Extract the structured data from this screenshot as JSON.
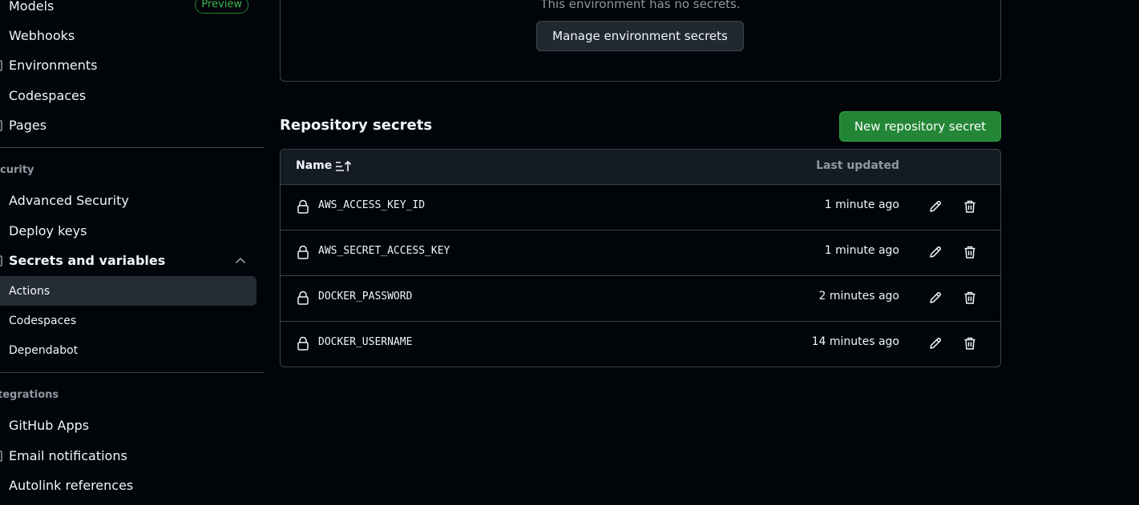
{
  "sidebar": {
    "items": [
      {
        "label": "Models",
        "badge": "Preview"
      },
      {
        "label": "Webhooks"
      },
      {
        "label": "Environments"
      },
      {
        "label": "Codespaces"
      },
      {
        "label": "Pages"
      }
    ],
    "security_section": "curity",
    "security_items": [
      {
        "label": "Advanced Security"
      },
      {
        "label": "Deploy keys"
      },
      {
        "label": "Secrets and variables"
      }
    ],
    "secrets_sub": [
      {
        "label": "Actions"
      },
      {
        "label": "Codespaces"
      },
      {
        "label": "Dependabot"
      }
    ],
    "integrations_section": "tegrations",
    "integration_items": [
      {
        "label": "GitHub Apps"
      },
      {
        "label": "Email notifications"
      },
      {
        "label": "Autolink references"
      }
    ]
  },
  "environment": {
    "empty_text": "This environment has no secrets.",
    "manage_button": "Manage environment secrets"
  },
  "repo_secrets": {
    "title": "Repository secrets",
    "new_button": "New repository secret",
    "columns": {
      "name": "Name",
      "updated": "Last updated"
    },
    "rows": [
      {
        "name": "AWS_ACCESS_KEY_ID",
        "updated": "1 minute ago"
      },
      {
        "name": "AWS_SECRET_ACCESS_KEY",
        "updated": "1 minute ago"
      },
      {
        "name": "DOCKER_PASSWORD",
        "updated": "2 minutes ago"
      },
      {
        "name": "DOCKER_USERNAME",
        "updated": "14 minutes ago"
      }
    ]
  },
  "colors": {
    "background": "#010409",
    "border": "#3d444d",
    "primary_button": "#238636",
    "active_nav": "#262c36"
  }
}
